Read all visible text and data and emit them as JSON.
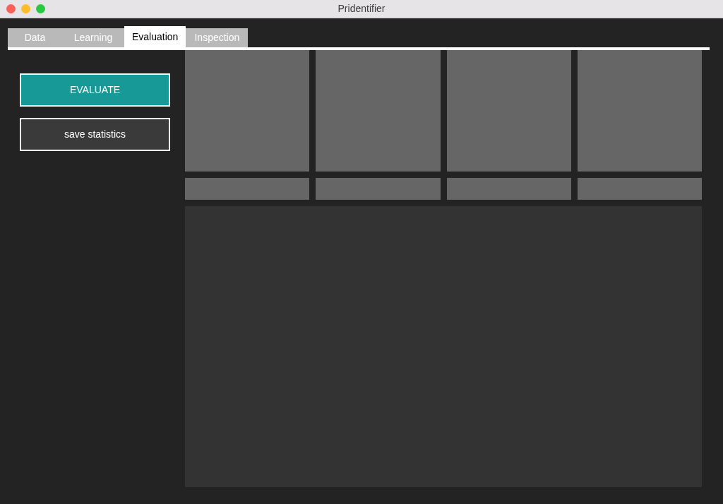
{
  "window": {
    "title": "Pridentifier"
  },
  "tabs": [
    {
      "label": "Data",
      "selected": false
    },
    {
      "label": "Learning",
      "selected": false
    },
    {
      "label": "Evaluation",
      "selected": true
    },
    {
      "label": "Inspection",
      "selected": false
    }
  ],
  "buttons": [
    {
      "label": "EVALUATE",
      "kind": "primary"
    },
    {
      "label": "save statistics",
      "kind": "secondary"
    }
  ]
}
